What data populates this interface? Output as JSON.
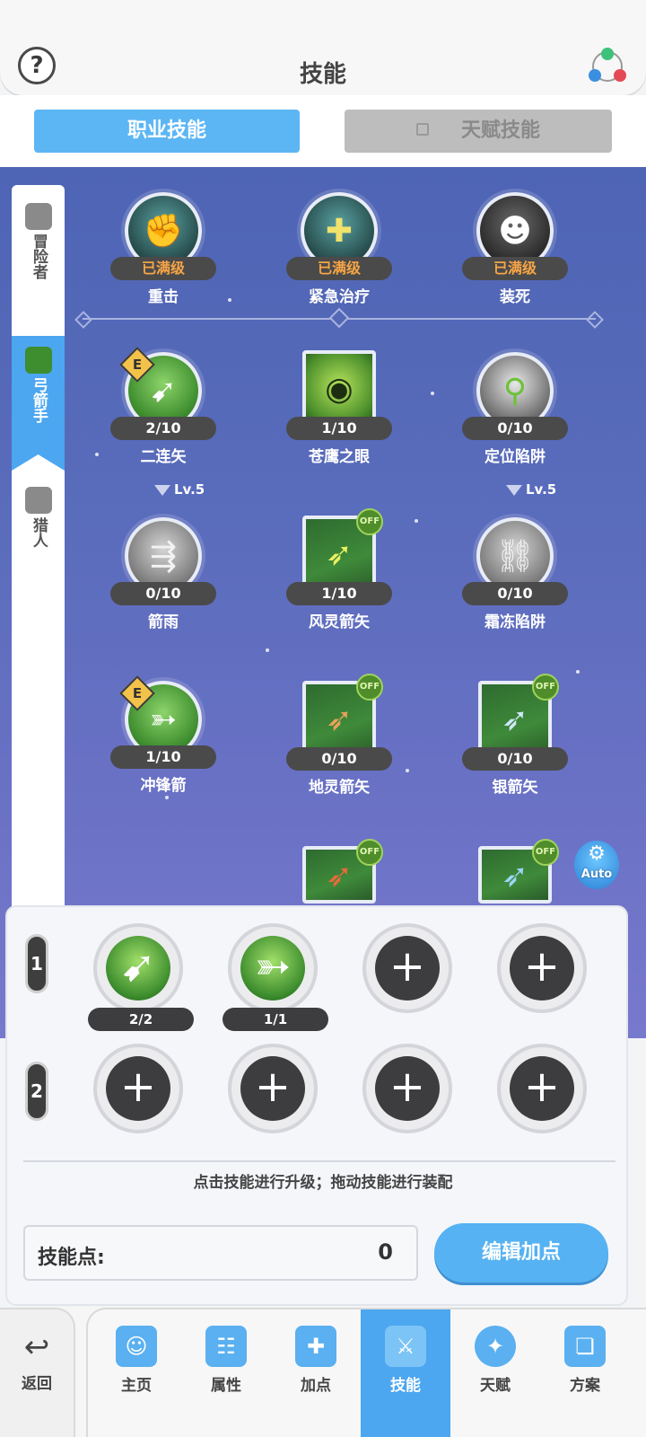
{
  "header": {
    "title": "技能",
    "help_label": "?"
  },
  "tabs": {
    "job_skills": "职业技能",
    "talent_skills": "天赋技能"
  },
  "side_tabs": [
    {
      "label": "冒险者"
    },
    {
      "label": "弓箭手"
    },
    {
      "label": "猎人"
    }
  ],
  "skills": {
    "s1": {
      "name": "重击",
      "level": "已满级"
    },
    "s2": {
      "name": "紧急治疗",
      "level": "已满级"
    },
    "s3": {
      "name": "装死",
      "level": "已满级"
    },
    "s4": {
      "name": "二连矢",
      "level": "2/10",
      "badge": "E"
    },
    "s5": {
      "name": "苍鹰之眼",
      "level": "1/10"
    },
    "s6": {
      "name": "定位陷阱",
      "level": "0/10"
    },
    "s7": {
      "name": "箭雨",
      "level": "0/10"
    },
    "s8": {
      "name": "风灵箭矢",
      "level": "1/10",
      "badge": "OFF"
    },
    "s9": {
      "name": "霜冻陷阱",
      "level": "0/10"
    },
    "s10": {
      "name": "冲锋箭",
      "level": "1/10",
      "badge": "E"
    },
    "s11": {
      "name": "地灵箭矢",
      "level": "0/10",
      "badge": "OFF"
    },
    "s12": {
      "name": "银箭矢",
      "level": "0/10",
      "badge": "OFF"
    },
    "s13": {
      "badge": "OFF"
    },
    "s14": {
      "badge": "OFF"
    }
  },
  "requirements": {
    "left": "Lv.5",
    "right": "Lv.5"
  },
  "auto_label": "Auto",
  "loadout": {
    "row1_label": "1",
    "row2_label": "2",
    "slot1_count": "2/2",
    "slot2_count": "1/1",
    "add_symbol": "+"
  },
  "hint": "点击技能进行升级；拖动技能进行装配",
  "points": {
    "label": "技能点:",
    "value": "0"
  },
  "edit_button": "编辑加点",
  "nav": {
    "back": "返回",
    "items": [
      {
        "label": "主页"
      },
      {
        "label": "属性"
      },
      {
        "label": "加点"
      },
      {
        "label": "技能"
      },
      {
        "label": "天赋"
      },
      {
        "label": "方案"
      }
    ]
  },
  "colors": {
    "accent": "#4ca6f0",
    "max_level": "#f6a545",
    "skill_bg": "#5a6cbc"
  }
}
